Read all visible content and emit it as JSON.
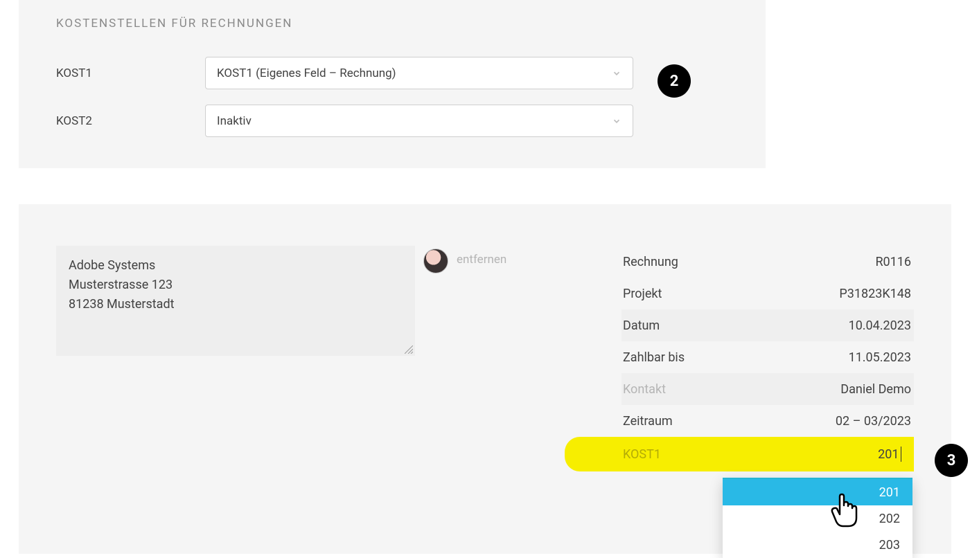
{
  "section": {
    "title": "KOSTENSTELLEN FÜR RECHNUNGEN",
    "rows": [
      {
        "label": "KOST1",
        "value": "KOST1 (Eigenes Feld – Rechnung)"
      },
      {
        "label": "KOST2",
        "value": "Inaktiv"
      }
    ]
  },
  "badges": {
    "two": "2",
    "three": "3"
  },
  "invoice": {
    "address": {
      "line1": "Adobe Systems",
      "line2": "Musterstrasse 123",
      "line3": "81238 Musterstadt"
    },
    "remove_label": "entfernen",
    "meta": {
      "rechnung": {
        "label": "Rechnung",
        "value": "R0116"
      },
      "projekt": {
        "label": "Projekt",
        "value": "P31823K148"
      },
      "datum": {
        "label": "Datum",
        "value": "10.04.2023"
      },
      "zahlbar": {
        "label": "Zahlbar bis",
        "value": "11.05.2023"
      },
      "kontakt": {
        "label": "Kontakt",
        "value": "Daniel Demo"
      },
      "zeitraum": {
        "label": "Zeitraum",
        "value": "02 – 03/2023"
      },
      "kost1": {
        "label": "KOST1",
        "input_value": "201"
      }
    },
    "dropdown": {
      "options": [
        "201",
        "202",
        "203"
      ]
    }
  }
}
